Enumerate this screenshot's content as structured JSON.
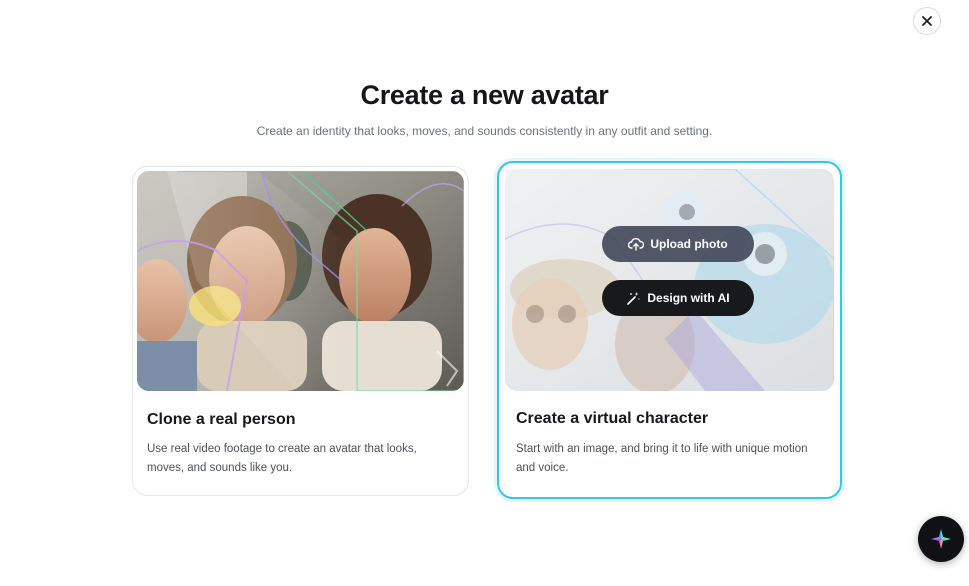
{
  "modal": {
    "title": "Create a new avatar",
    "subtitle": "Create an identity that looks, moves, and sounds consistently in any outfit and setting."
  },
  "close_icon": "close-icon",
  "cards": [
    {
      "id": "clone",
      "title": "Clone a real person",
      "description": "Use real video footage to create an avatar that looks, moves, and sounds like you.",
      "selected": false
    },
    {
      "id": "virtual",
      "title": "Create a virtual character",
      "description": "Start with an image, and bring it to life with unique motion and voice.",
      "selected": true,
      "actions": {
        "upload_label": "Upload photo",
        "upload_icon": "cloud-upload-icon",
        "design_label": "Design with AI",
        "design_icon": "magic-wand-icon"
      }
    }
  ],
  "fab": {
    "icon": "assistant-sparkle-icon"
  },
  "colors": {
    "selected_border": "#35c6ea",
    "title_text": "#14161a",
    "subtitle_text": "#6b7078",
    "dark_button": "#17191d"
  }
}
